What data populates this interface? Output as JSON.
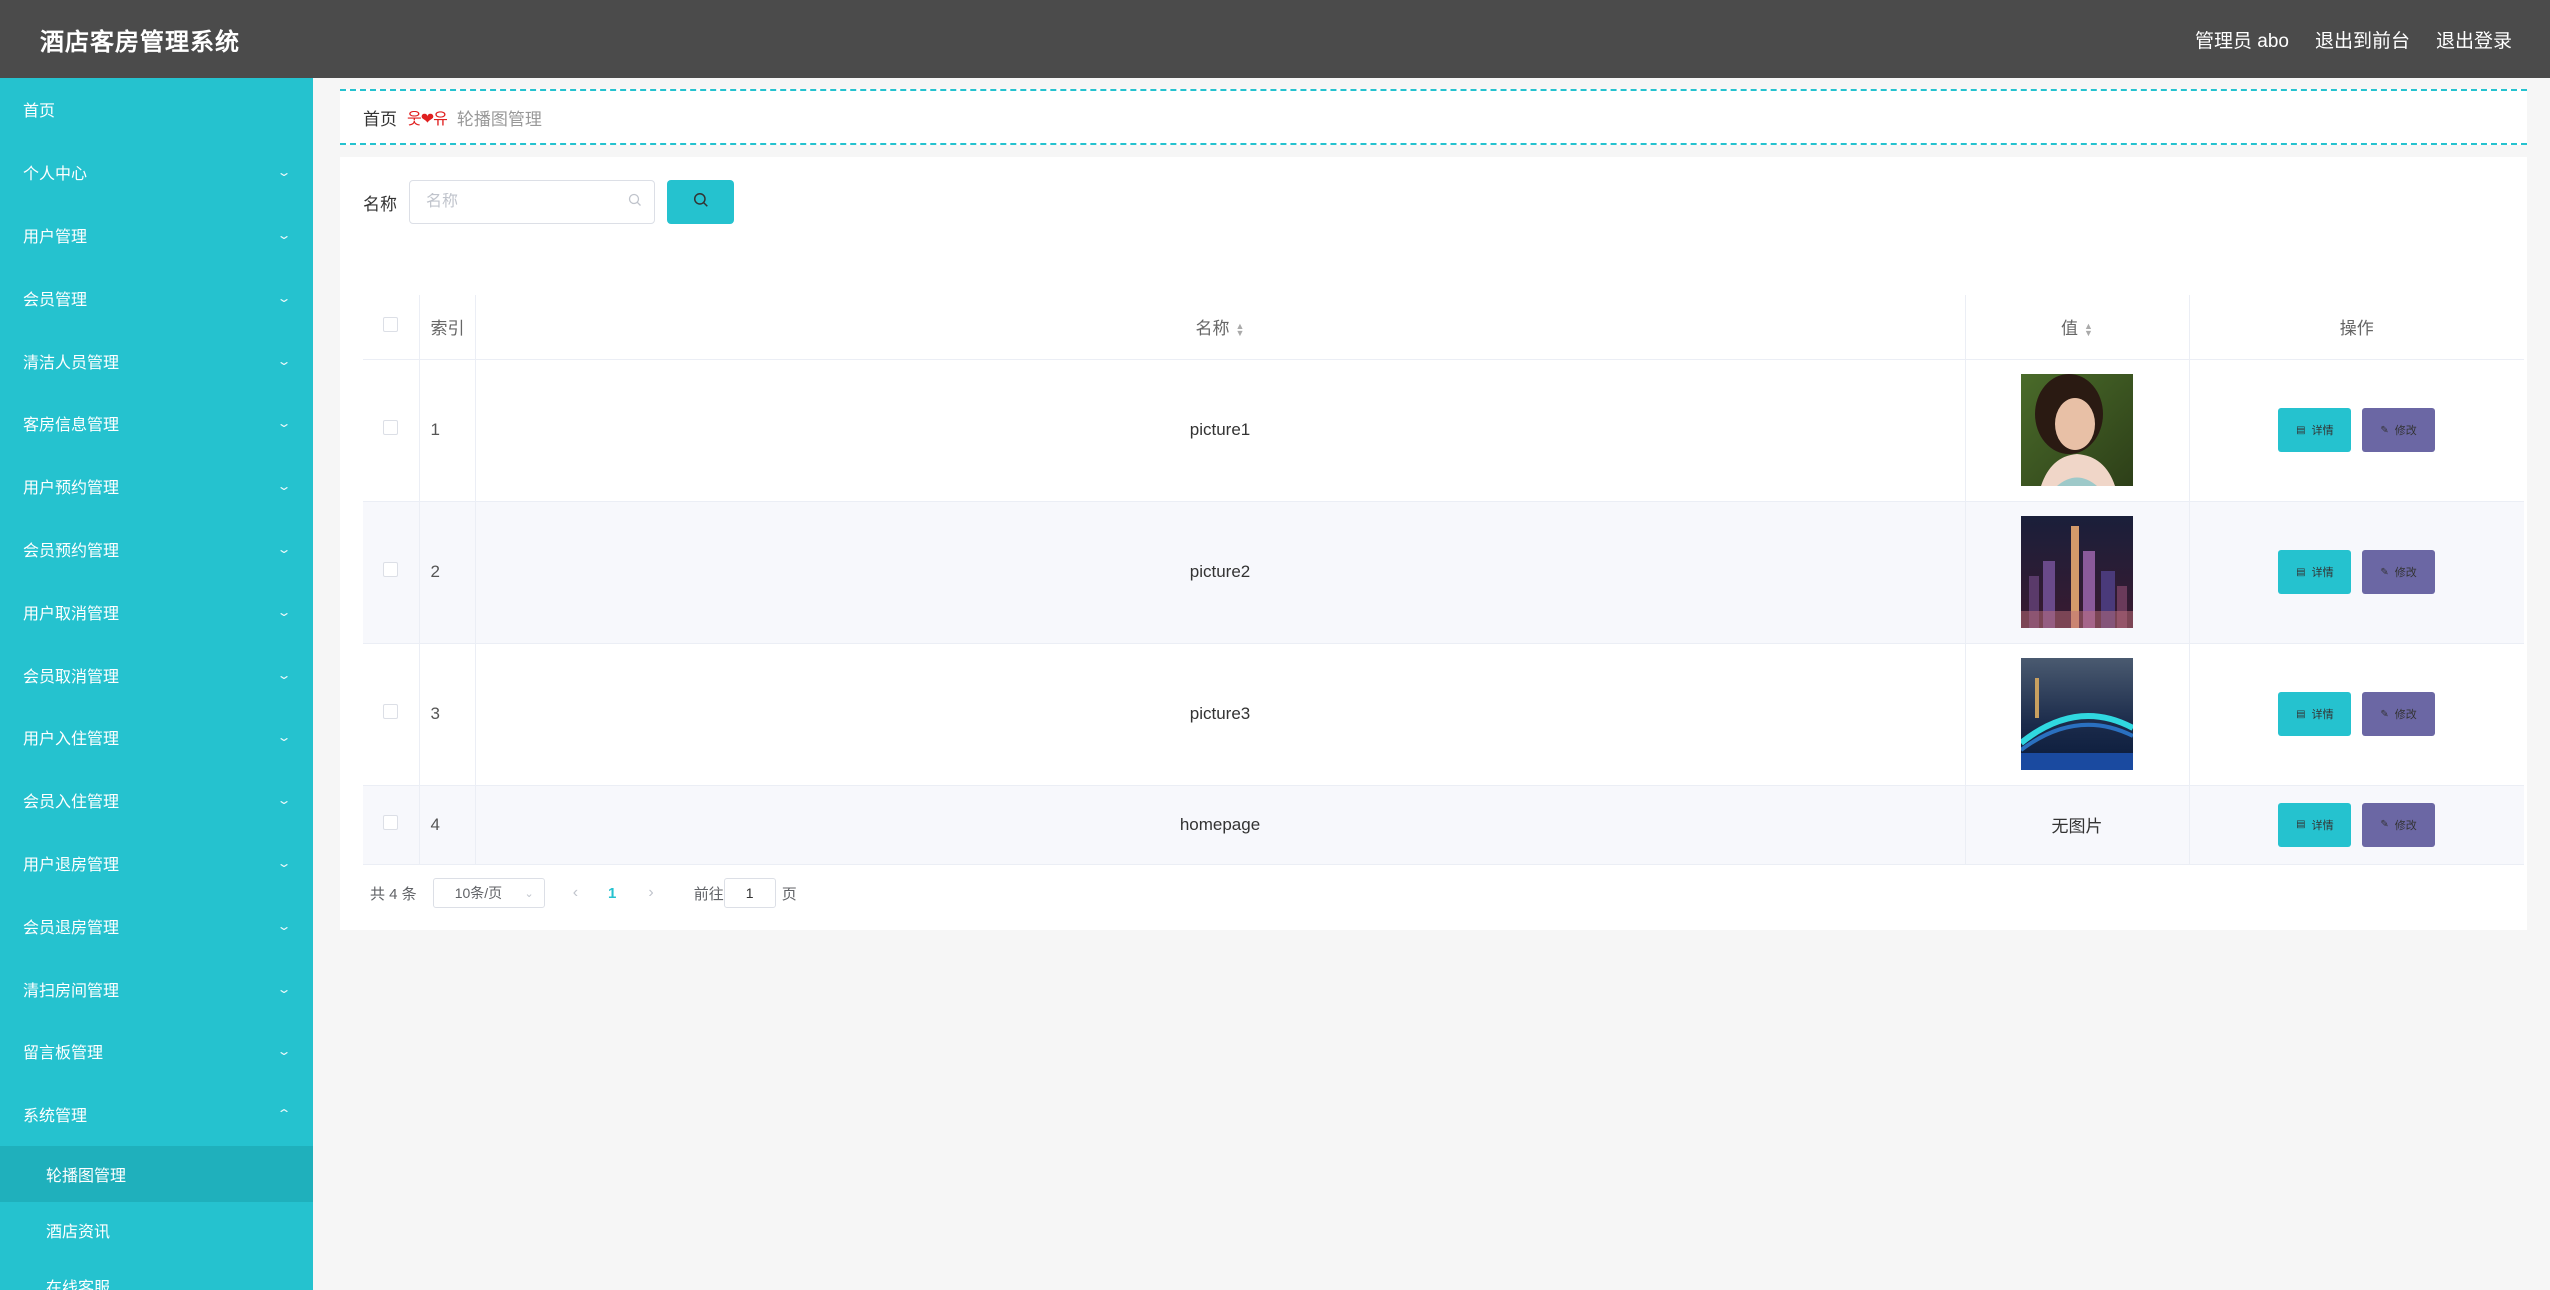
{
  "app": {
    "title": "酒店客房管理系统"
  },
  "header": {
    "user": "管理员 abo",
    "to_front": "退出到前台",
    "logout": "退出登录"
  },
  "sidebar": {
    "items": [
      {
        "label": "首页",
        "chevron": false
      },
      {
        "label": "个人中心",
        "chevron": true
      },
      {
        "label": "用户管理",
        "chevron": true
      },
      {
        "label": "会员管理",
        "chevron": true
      },
      {
        "label": "清洁人员管理",
        "chevron": true
      },
      {
        "label": "客房信息管理",
        "chevron": true
      },
      {
        "label": "用户预约管理",
        "chevron": true
      },
      {
        "label": "会员预约管理",
        "chevron": true
      },
      {
        "label": "用户取消管理",
        "chevron": true
      },
      {
        "label": "会员取消管理",
        "chevron": true
      },
      {
        "label": "用户入住管理",
        "chevron": true
      },
      {
        "label": "会员入住管理",
        "chevron": true
      },
      {
        "label": "用户退房管理",
        "chevron": true
      },
      {
        "label": "会员退房管理",
        "chevron": true
      },
      {
        "label": "清扫房间管理",
        "chevron": true
      },
      {
        "label": "留言板管理",
        "chevron": true
      },
      {
        "label": "系统管理",
        "chevron": true,
        "expanded": true
      }
    ],
    "sub_items": [
      {
        "label": "轮播图管理",
        "active": true
      },
      {
        "label": "酒店资讯",
        "active": false
      },
      {
        "label": "在线客服",
        "active": false
      }
    ]
  },
  "breadcrumb": {
    "home": "首页",
    "separator": "웃❤유",
    "current": "轮播图管理"
  },
  "search": {
    "label": "名称",
    "placeholder": "名称"
  },
  "table": {
    "columns": {
      "index": "索引",
      "name": "名称",
      "value": "值",
      "ops": "操作"
    },
    "rows": [
      {
        "index": "1",
        "name": "picture1",
        "image": "portrait"
      },
      {
        "index": "2",
        "name": "picture2",
        "image": "city-night"
      },
      {
        "index": "3",
        "name": "picture3",
        "image": "bridge-night"
      },
      {
        "index": "4",
        "name": "homepage",
        "value_text": "无图片"
      }
    ],
    "detail_label": "详情",
    "edit_label": "修改"
  },
  "pagination": {
    "total": "共 4 条",
    "page_size": "10条/页",
    "current_page": "1",
    "goto_prefix": "前往",
    "goto_value": "1",
    "goto_suffix": "页"
  },
  "colors": {
    "accent": "#25c2cf",
    "topbar": "#4b4b4b",
    "edit": "#6b67a4"
  }
}
